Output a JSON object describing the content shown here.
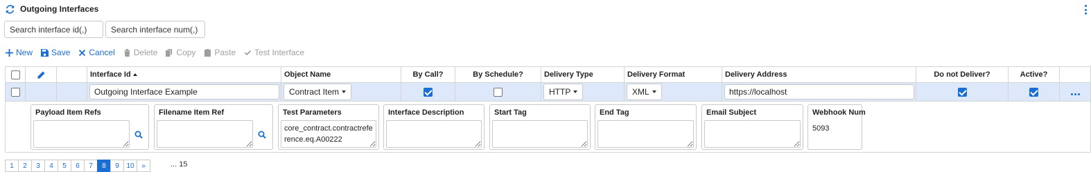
{
  "header": {
    "title": "Outgoing Interfaces"
  },
  "search": {
    "id_placeholder": "Search interface id(,)",
    "num_placeholder": "Search interface num(,)"
  },
  "toolbar": {
    "new_label": "New",
    "save_label": "Save",
    "cancel_label": "Cancel",
    "delete_label": "Delete",
    "copy_label": "Copy",
    "paste_label": "Paste",
    "test_label": "Test Interface"
  },
  "columns": {
    "interface_id": "Interface Id",
    "object_name": "Object Name",
    "by_call": "By Call?",
    "by_schedule": "By Schedule?",
    "delivery_type": "Delivery Type",
    "delivery_format": "Delivery Format",
    "delivery_address": "Delivery Address",
    "do_not_deliver": "Do not Deliver?",
    "active": "Active?"
  },
  "row": {
    "selected": false,
    "interface_id": "Outgoing Interface Example",
    "object_name": "Contract Item",
    "by_call": true,
    "by_schedule": false,
    "delivery_type": "HTTP",
    "delivery_format": "XML",
    "delivery_address": "https://localhost",
    "do_not_deliver": true,
    "active": true
  },
  "detail": {
    "payload_label": "Payload Item Refs",
    "payload_value": "",
    "filename_label": "Filename Item Ref",
    "filename_value": "",
    "test_params_label": "Test Parameters",
    "test_params_value": "core_contract.contractreference.eq.A00222",
    "description_label": "Interface Description",
    "description_value": "",
    "start_tag_label": "Start Tag",
    "start_tag_value": "",
    "end_tag_label": "End Tag",
    "end_tag_value": "",
    "email_subject_label": "Email Subject",
    "email_subject_value": "",
    "webhook_label": "Webhook Num",
    "webhook_value": "5093"
  },
  "pagination": {
    "pages": [
      "1",
      "2",
      "3",
      "4",
      "5",
      "6",
      "7",
      "8",
      "9",
      "10",
      "»"
    ],
    "active_index": 7,
    "info": "... 15"
  },
  "colors": {
    "accent": "#1b6ed2",
    "row_selected": "#dde9fb",
    "disabled": "#9e9e9e"
  }
}
